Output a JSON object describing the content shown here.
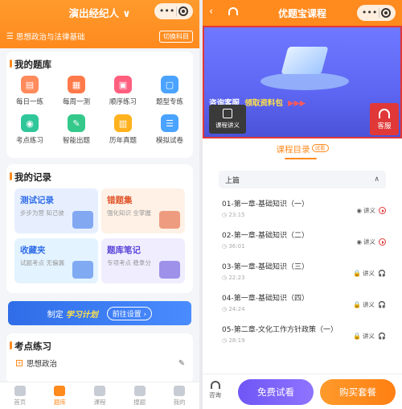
{
  "left": {
    "title": "演出经纪人",
    "title_arrow": "∨",
    "subject_menu": "☰",
    "subject": "思想政治与法律基础",
    "switch_subject": "切换科目",
    "bank": {
      "title": "我的题库",
      "items": [
        {
          "label": "每日一练",
          "color": "#ff8a5c",
          "glyph": "▤"
        },
        {
          "label": "每周一测",
          "color": "#ff7a4a",
          "glyph": "▦"
        },
        {
          "label": "顺序练习",
          "color": "#ff5f7f",
          "glyph": "▣"
        },
        {
          "label": "题型专练",
          "color": "#4aa3ff",
          "glyph": "▢"
        },
        {
          "label": "考点练习",
          "color": "#2fc79a",
          "glyph": "◉"
        },
        {
          "label": "智能出题",
          "color": "#34c98b",
          "glyph": "✎"
        },
        {
          "label": "历年真题",
          "color": "#ffb21e",
          "glyph": "▥"
        },
        {
          "label": "模拟试卷",
          "color": "#4aa3ff",
          "glyph": "☰"
        }
      ]
    },
    "records": {
      "title": "我的记录",
      "items": [
        {
          "title": "测试记录",
          "sub": "步步为营 知己彼",
          "bg": "#e7efff",
          "color": "#2f6de8"
        },
        {
          "title": "错题集",
          "sub": "强化知识 全掌握",
          "bg": "#fff1e6",
          "color": "#e0552a"
        },
        {
          "title": "收藏夹",
          "sub": "试题考点 无偏漏",
          "bg": "#e3f3ff",
          "color": "#2f6de8"
        },
        {
          "title": "题库笔记",
          "sub": "专项考点 稳拿分",
          "bg": "#f0edff",
          "color": "#5a45d8"
        }
      ]
    },
    "plan": {
      "prefix": "制定",
      "bold": "学习计划",
      "button": "前往设置 ›"
    },
    "practice": {
      "title": "考点练习",
      "first": "思想政治",
      "edit_icon": "✎"
    },
    "tabs": [
      {
        "label": "首页",
        "active": false
      },
      {
        "label": "题库",
        "active": true
      },
      {
        "label": "课程",
        "active": false
      },
      {
        "label": "搜题",
        "active": false
      },
      {
        "label": "我的",
        "active": false
      }
    ]
  },
  "right": {
    "back": "‹",
    "title": "优题宝课程",
    "promo": {
      "a": "咨询客服",
      "b": "领取资料包",
      "c": "▶▶▶"
    },
    "video_button": "课程讲义",
    "service": "客服",
    "catalog": "课程目录",
    "catalog_badge": "试看",
    "chapter": "上篇",
    "chapter_arrow": "∧",
    "lessons": [
      {
        "name": "01-第一章-基础知识（一）",
        "duration": "23:15",
        "locked": false
      },
      {
        "name": "02-第一章-基础知识（二）",
        "duration": "36:01",
        "locked": false
      },
      {
        "name": "03-第一章-基础知识（三）",
        "duration": "22:23",
        "locked": true
      },
      {
        "name": "04-第一章-基础知识（四）",
        "duration": "24:24",
        "locked": true
      },
      {
        "name": "05-第二章-文化工作方针政策（一）",
        "duration": "28:19",
        "locked": true
      }
    ],
    "lesson_note": "讲义",
    "consult": "咨询",
    "try_button": "免费试看",
    "buy_button": "购买套餐"
  }
}
